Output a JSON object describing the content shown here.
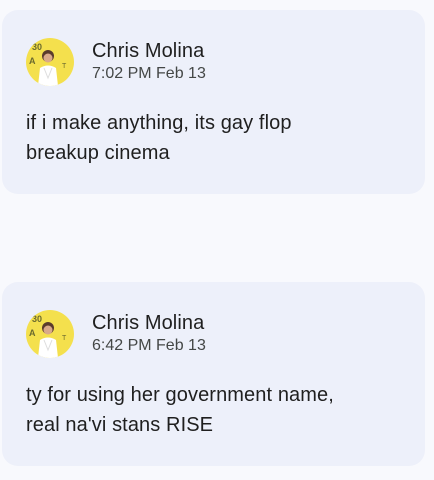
{
  "comments": [
    {
      "author": "Chris Molina",
      "timestamp": "7:02 PM Feb 13",
      "text": "if i make anything, its gay flop\nbreakup cinema"
    },
    {
      "author": "Chris Molina",
      "timestamp": "6:42 PM Feb 13",
      "text": "ty for using her government name,\nreal na'vi stans RISE"
    }
  ],
  "colors": {
    "card_background": "#edf0fa",
    "page_background": "#f8f9fd",
    "avatar_background": "#f4e04d"
  }
}
